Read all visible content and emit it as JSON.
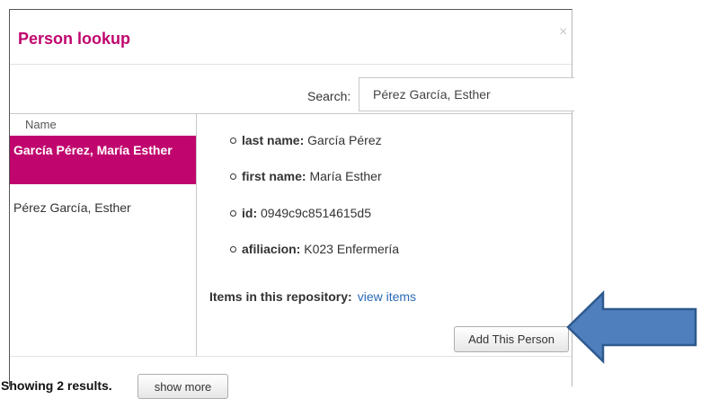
{
  "dialog": {
    "title": "Person lookup",
    "close_glyph": "×"
  },
  "search": {
    "label": "Search:",
    "value": "Pérez García, Esther"
  },
  "results_list": {
    "column_header": "Name",
    "rows": [
      {
        "name": "García Pérez, María Esther",
        "selected": true
      },
      {
        "name": "Pérez García, Esther",
        "selected": false
      }
    ]
  },
  "details": {
    "attributes": [
      {
        "key": "last name:",
        "value": "García Pérez"
      },
      {
        "key": "first name:",
        "value": "María Esther"
      },
      {
        "key": "id:",
        "value": "0949c9c8514615d5"
      },
      {
        "key": "afiliacion:",
        "value": "K023 Enfermería"
      }
    ],
    "items_label": "Items in this repository:",
    "items_link": "view items",
    "add_button": "Add This Person"
  },
  "footer": {
    "showing": "Showing 2 results.",
    "show_more": "show more"
  },
  "annotation": {
    "icon": "arrow-left-icon",
    "fill": "#4f7fbd",
    "stroke": "#2f5a8e"
  },
  "colors": {
    "accent": "#c0066e",
    "link": "#2a6ab5"
  }
}
